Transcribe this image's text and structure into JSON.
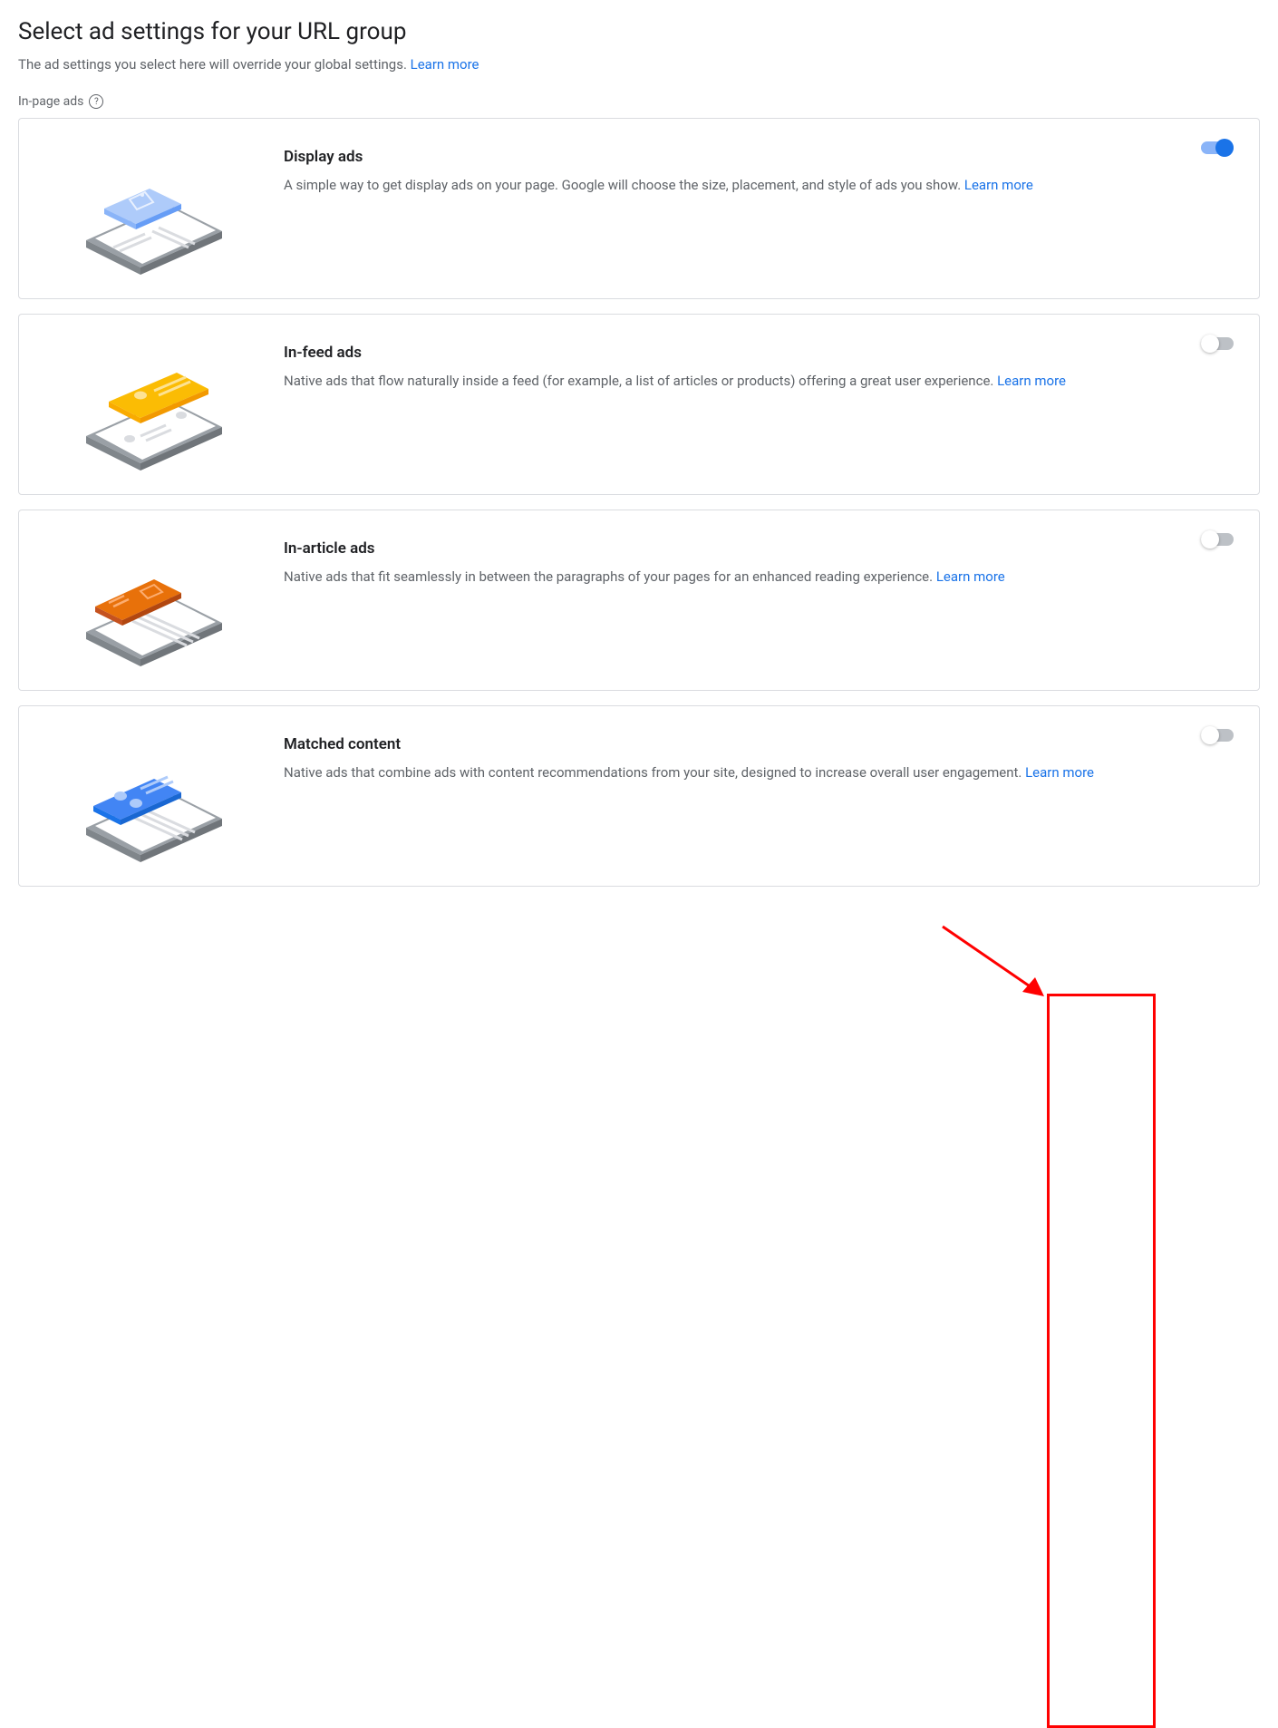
{
  "header": {
    "title": "Select ad settings for your URL group",
    "subtitle": "The ad settings you select here will override your global settings. ",
    "learn_more": "Learn more"
  },
  "section": {
    "label": "In-page ads"
  },
  "cards": [
    {
      "title": "Display ads",
      "description": "A simple way to get display ads on your page. Google will choose the size, placement, and style of ads you show. ",
      "learn_more": "Learn more",
      "enabled": true,
      "color": "blue"
    },
    {
      "title": "In-feed ads",
      "description": "Native ads that flow naturally inside a feed (for example, a list of articles or products) offering a great user experience. ",
      "learn_more": "Learn more",
      "enabled": false,
      "color": "yellow"
    },
    {
      "title": "In-article ads",
      "description": "Native ads that fit seamlessly in between the paragraphs of your pages for an enhanced reading experience. ",
      "learn_more": "Learn more",
      "enabled": false,
      "color": "orange"
    },
    {
      "title": "Matched content",
      "description": "Native ads that combine ads with content recommendations from your site, designed to increase overall user engagement. ",
      "learn_more": "Learn more",
      "enabled": false,
      "color": "blue2"
    }
  ]
}
